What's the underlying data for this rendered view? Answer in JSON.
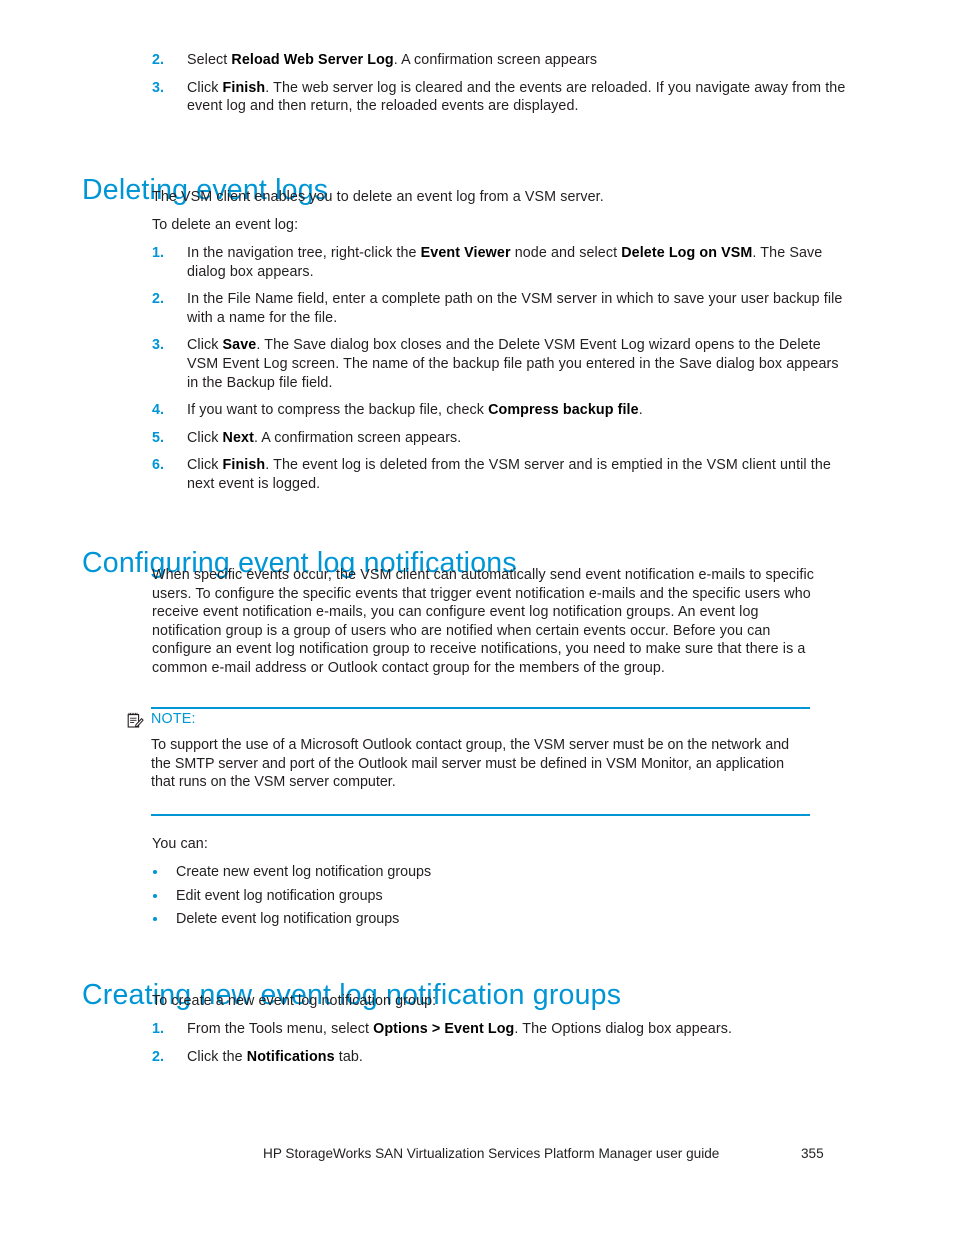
{
  "page": {
    "accent_color": "#0096d6",
    "text_color": "#231f20"
  },
  "top_steps": [
    {
      "number": "2.",
      "html": "Select <b>Reload Web Server Log</b>. A confirmation screen appears"
    },
    {
      "number": "3.",
      "html": "Click <b>Finish</b>. The web server log is cleared and the events are reloaded. If you navigate away from the event log and then return, the reloaded events are displayed."
    }
  ],
  "deleting_section": {
    "heading": "Deleting event logs",
    "intro": "The VSM client enables you to delete an event log from a VSM server.",
    "lead_in": "To delete an event log:",
    "steps": [
      {
        "number": "1.",
        "html": "In the navigation tree, right-click the <b>Event Viewer</b> node and select <b>Delete Log on VSM</b>. The Save dialog box appears."
      },
      {
        "number": "2.",
        "html": "In the File Name field, enter a complete path on the VSM server in which to save your user backup file with a name for the file."
      },
      {
        "number": "3.",
        "html": "Click <b>Save</b>. The Save dialog box closes and the Delete VSM Event Log wizard opens to the Delete VSM Event Log screen. The name of the backup file path you entered in the Save dialog box appears in the Backup file field."
      },
      {
        "number": "4.",
        "html": "If you want to compress the backup file, check <b>Compress backup file</b>."
      },
      {
        "number": "5.",
        "html": "Click <b>Next</b>. A confirmation screen appears."
      },
      {
        "number": "6.",
        "html": "Click <b>Finish</b>. The event log is deleted from the VSM server and is emptied in the VSM client until the next event is logged."
      }
    ]
  },
  "configuring_section": {
    "heading": "Configuring event log notifications",
    "paragraph": "When specific events occur, the VSM client can automatically send event notification e-mails to specific users. To configure the specific events that trigger event notification e-mails and the specific users who receive event notification e-mails, you can configure event log notification groups. An event log notification group is a group of users who are notified when certain events occur. Before you can configure an event log notification group to receive notifications, you need to make sure that there is a common e-mail address or Outlook contact group for the members of the group.",
    "note": {
      "icon": "note-pencil-icon",
      "label": "NOTE:",
      "text": "To support the use of a Microsoft Outlook contact group, the VSM server must be on the network and the SMTP server and port of the Outlook mail server must be defined in VSM Monitor, an application that runs on the VSM server computer."
    },
    "you_can_label": "You can:",
    "bullets": [
      "Create new event log notification groups",
      "Edit event log notification groups",
      "Delete event log notification groups"
    ]
  },
  "creating_section": {
    "heading": "Creating new event log notification groups",
    "lead_in": "To create a new event log notification group:",
    "steps": [
      {
        "number": "1.",
        "html": "From the Tools menu, select <b>Options &gt; Event Log</b>. The Options dialog box appears."
      },
      {
        "number": "2.",
        "html": "Click the <b>Notifications</b> tab."
      }
    ]
  },
  "footer": {
    "title": "HP StorageWorks SAN Virtualization Services Platform Manager user guide",
    "page_number": "355"
  }
}
